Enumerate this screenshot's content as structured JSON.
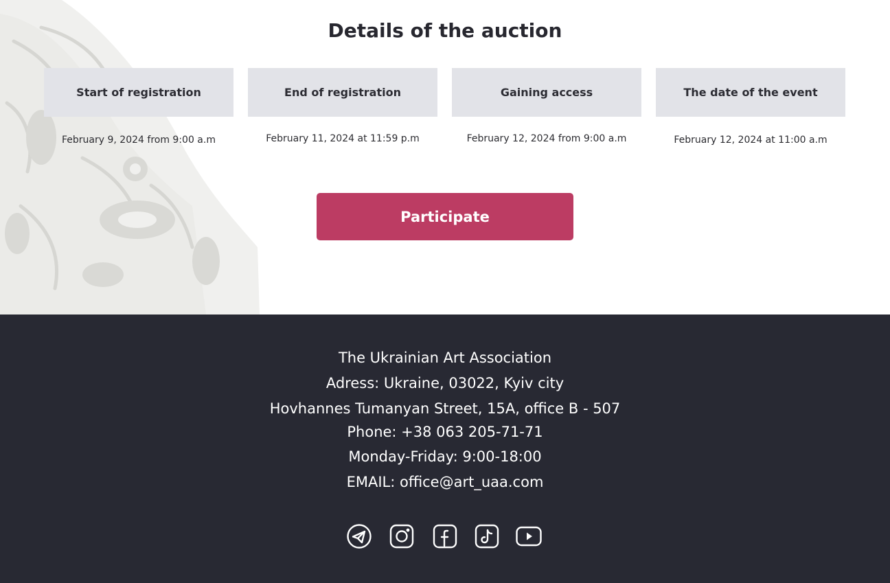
{
  "section": {
    "title": "Details of the auction"
  },
  "stages": [
    {
      "label": "Start of registration",
      "date": "February 9, 2024 from 9:00 a.m"
    },
    {
      "label": "End of registration",
      "date": "February 11, 2024 at 11:59 p.m"
    },
    {
      "label": "Gaining access",
      "date": "February 12, 2024 from 9:00 a.m"
    },
    {
      "label": "The date of the event",
      "date": "February 12, 2024 at 11:00 a.m"
    }
  ],
  "cta": {
    "label": "Participate",
    "color": "#bc3c63"
  },
  "footer": {
    "org": "The Ukrainian Art Association",
    "address": "Adress: Ukraine, 03022, Kyiv city",
    "street": "Hovhannes Tumanyan Street, 15A, office B - 507",
    "phone": "Phone: +38 063 205-71-71",
    "hours": "Monday-Friday: 9:00-18:00",
    "email": "EMAIL: office@art_uaa.com",
    "background": "#282933",
    "social": [
      "telegram-icon",
      "instagram-icon",
      "facebook-icon",
      "tiktok-icon",
      "youtube-icon"
    ]
  }
}
